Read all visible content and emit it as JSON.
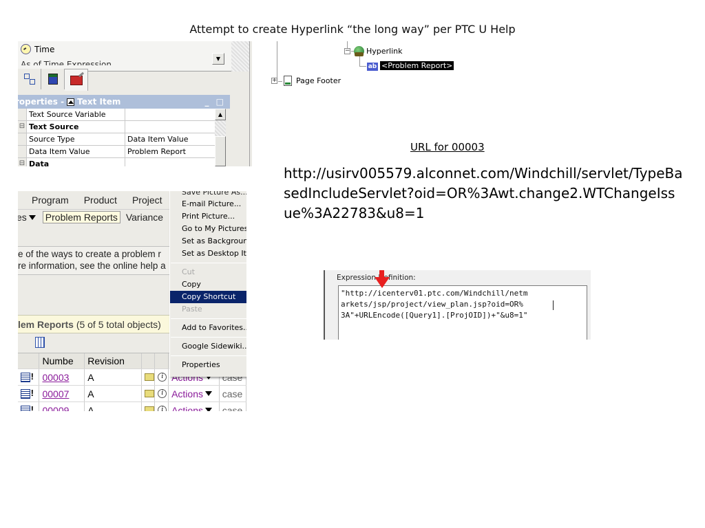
{
  "slide": {
    "title": "Attempt to create Hyperlink “the long way” per PTC U Help"
  },
  "properties_panel": {
    "time_label": "Time",
    "as_of_label": "As of Time Expression",
    "header_title": "roperties - ",
    "header_item": "Text Item",
    "header_controls": "_ □",
    "rows": [
      {
        "expander": "",
        "key": "Text Source Variable",
        "value": "",
        "bold": false
      },
      {
        "expander": "⊟",
        "key": "Text Source",
        "value": "",
        "bold": true
      },
      {
        "expander": "",
        "key": "Source Type",
        "value": "Data Item Value",
        "bold": false
      },
      {
        "expander": "",
        "key": "Data Item Value",
        "value": "Problem Report",
        "bold": false
      },
      {
        "expander": "⊟",
        "key": "Data",
        "value": "",
        "bold": true
      }
    ],
    "tab_icons": [
      "tree-icon",
      "table-icon",
      "tools-icon"
    ]
  },
  "tree": {
    "hyperlink_label": "Hyperlink",
    "selected_node": "<Problem Report>",
    "page_footer_label": "Page Footer",
    "collapse_symbol": "−",
    "expand_symbol": "+",
    "ab_label": "ab"
  },
  "url_section": {
    "heading": "URL for 00003",
    "url": "http://usirv005579.alconnet.com/Windchill/servlet/TypeBasedIncludeServlet?oid=OR%3Awt.change2.WTChangeIssue%3A22783&u8=1"
  },
  "windchill": {
    "nav_top": [
      "Program",
      "Product",
      "Project"
    ],
    "nav_sub_partial": "es",
    "nav_sub_active": "Problem Reports",
    "nav_sub_next": "Variance",
    "info_line1": "e of the ways to create a problem r",
    "info_line2": "re information, see the online help a",
    "list_title": "lem Reports",
    "list_count": "(5 of 5 total objects)",
    "columns": [
      "",
      "Numbe",
      "Revision",
      "",
      "",
      "",
      ""
    ],
    "rows": [
      {
        "number": "00003",
        "revision": "A",
        "actions": "Actions",
        "type": "case"
      },
      {
        "number": "00007",
        "revision": "A",
        "actions": "Actions",
        "type": "case"
      },
      {
        "number": "00009",
        "revision": "A",
        "actions": "Actions",
        "type": "case"
      }
    ]
  },
  "context_menu": {
    "partial_top": "Save Picture As...",
    "items": [
      {
        "label": "E-mail Picture...",
        "state": "normal"
      },
      {
        "label": "Print Picture...",
        "state": "normal"
      },
      {
        "label": "Go to My Pictures",
        "state": "normal"
      },
      {
        "label": "Set as Background",
        "state": "normal"
      },
      {
        "label": "Set as Desktop Item...",
        "state": "normal"
      },
      {
        "sep": true
      },
      {
        "label": "Cut",
        "state": "disabled"
      },
      {
        "label": "Copy",
        "state": "normal"
      },
      {
        "label": "Copy Shortcut",
        "state": "highlighted"
      },
      {
        "label": "Paste",
        "state": "disabled"
      },
      {
        "sep": true
      },
      {
        "label": "Add to Favorites...",
        "state": "normal"
      },
      {
        "sep": true
      },
      {
        "label": "Google Sidewiki...",
        "state": "normal"
      },
      {
        "sep": true
      },
      {
        "label": "Properties",
        "state": "normal"
      }
    ]
  },
  "expression": {
    "label": "Expression Definition:",
    "lines": [
      "\"http://icenterv01.ptc.com/Windchill/netm",
      "arkets/jsp/project/view_plan.jsp?oid=OR%",
      "3A\"+URLEncode([Query1].[ProjOID])+\"&u8=1\""
    ]
  }
}
